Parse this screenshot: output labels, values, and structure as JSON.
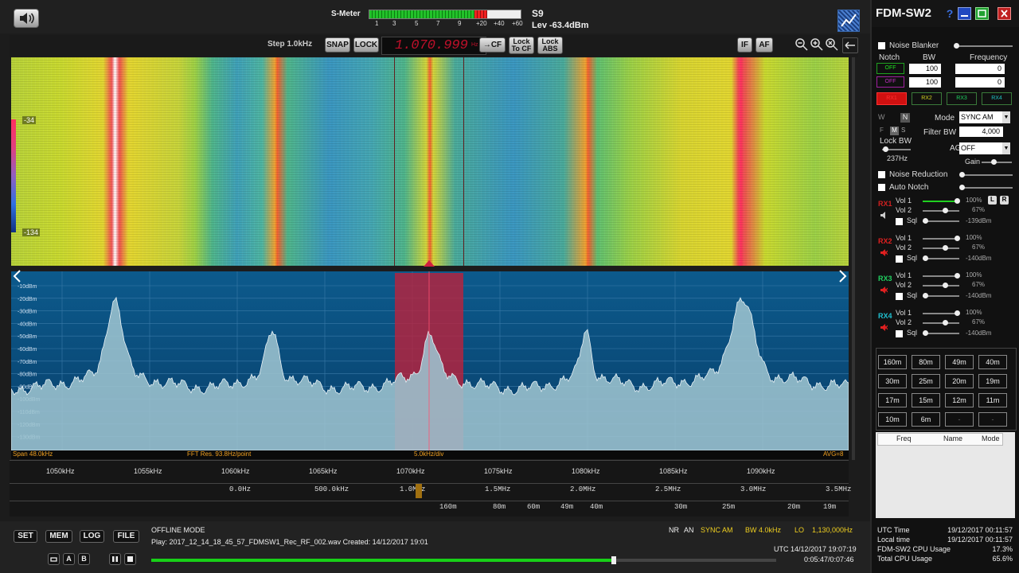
{
  "topbar": {
    "smeter_label": "S-Meter",
    "smeter_ticks": [
      "1",
      "3",
      "5",
      "7",
      "9",
      "+20",
      "+40",
      "+60"
    ],
    "s_reading": "S9",
    "level": "Lev -63.4dBm",
    "smeter_fill": 0.78
  },
  "ctrl": {
    "step": "Step 1.0kHz",
    "snap": "SNAP",
    "lock": "LOCK",
    "frequency": "1.070.999",
    "freq_unit": "Hz",
    "cf": "→CF",
    "lock_to_cf": "Lock To CF",
    "lock_abs": "Lock ABS",
    "if": "IF",
    "af": "AF"
  },
  "waterfall": {
    "top_level": "-34",
    "bottom_level": "-134"
  },
  "spectrum": {
    "db_labels": [
      "-10dBm",
      "-20dBm",
      "-30dBm",
      "-40dBm",
      "-50dBm",
      "-60dBm",
      "-70dBm",
      "-80dBm",
      "-90dBm",
      "-100dBm",
      "-110dBm",
      "-120dBm",
      "-130dBm"
    ],
    "span": "Span 48.0kHz",
    "fft_res": "FFT Res. 93.8Hz/point",
    "div": "5.0kHz/div",
    "avg": "AVG=8"
  },
  "scale": {
    "khz": [
      "1050kHz",
      "1055kHz",
      "1060kHz",
      "1065kHz",
      "1070kHz",
      "1075kHz",
      "1080kHz",
      "1085kHz",
      "1090kHz"
    ],
    "mhz": [
      "0.0Hz",
      "500.0kHz",
      "1.0MHz",
      "1.5MHz",
      "2.0MHz",
      "2.5MHz",
      "3.0MHz",
      "3.5MHz"
    ],
    "meters": [
      "160m",
      "80m",
      "60m",
      "49m",
      "40m",
      "30m",
      "25m",
      "20m",
      "19m"
    ]
  },
  "bottom": {
    "set": "SET",
    "mem": "MEM",
    "log": "LOG",
    "file": "FILE",
    "mode": "OFFLINE MODE",
    "play": "Play: 2017_12_14_18_45_57_FDMSW1_Rec_RF_002.wav Created: 14/12/2017 19:01",
    "nr": "NR",
    "an": "AN",
    "sync": "SYNC AM",
    "bw": "BW 4.0kHz",
    "lo": "LO",
    "lo_freq": "1,130,000Hz",
    "utc": "UTC 14/12/2017 19:07:19",
    "position": "0:05:47/0:07:46",
    "progress": 0.74
  },
  "side": {
    "title": "FDM-SW2",
    "noise_blanker": "Noise Blanker",
    "notch": "Notch",
    "bw": "BW",
    "frequency": "Frequency",
    "notch_rows": [
      {
        "state": "OFF",
        "bw": "100",
        "freq": "0"
      },
      {
        "state": "OFF",
        "bw": "100",
        "freq": "0"
      }
    ],
    "rx_buttons": [
      "RX1",
      "RX2",
      "RX3",
      "RX4"
    ],
    "w": "W",
    "n": "N",
    "f": "F",
    "m": "M",
    "s": "S",
    "mode_label": "Mode",
    "mode_value": "SYNC AM",
    "filter_bw_label": "Filter BW",
    "filter_bw_value": "4,000",
    "lock_bw": "Lock BW",
    "lock_bw_value": "237Hz",
    "agc_label": "AGC",
    "agc_value": "OFF",
    "gain": "Gain",
    "noise_reduction": "Noise Reduction",
    "auto_notch": "Auto Notch",
    "receivers": [
      {
        "name": "RX1",
        "vol1": "Vol 1",
        "vol1_val": "100%",
        "vol2": "Vol 2",
        "vol2_val": "67%",
        "sql": "Sql",
        "sql_val": "-139dBm"
      },
      {
        "name": "RX2",
        "vol1": "Vol 1",
        "vol1_val": "100%",
        "vol2": "Vol 2",
        "vol2_val": "67%",
        "sql": "Sql",
        "sql_val": "-140dBm"
      },
      {
        "name": "RX3",
        "vol1": "Vol 1",
        "vol1_val": "100%",
        "vol2": "Vol 2",
        "vol2_val": "67%",
        "sql": "Sql",
        "sql_val": "-140dBm"
      },
      {
        "name": "RX4",
        "vol1": "Vol 1",
        "vol1_val": "100%",
        "vol2": "Vol 2",
        "vol2_val": "67%",
        "sql": "Sql",
        "sql_val": "-140dBm"
      }
    ],
    "l": "L",
    "r": "R",
    "bands": [
      "160m",
      "80m",
      "49m",
      "40m",
      "30m",
      "25m",
      "20m",
      "19m",
      "17m",
      "15m",
      "12m",
      "11m",
      "10m",
      "6m",
      "-",
      "-"
    ],
    "mem_cols": [
      "Freq",
      "Name",
      "Mode"
    ],
    "status": [
      {
        "label": "UTC Time",
        "value": "19/12/2017 00:11:57"
      },
      {
        "label": "Local time",
        "value": "19/12/2017 00:11:57"
      },
      {
        "label": "FDM-SW2 CPU Usage",
        "value": "17.3%"
      },
      {
        "label": "Total CPU Usage",
        "value": "65.6%"
      }
    ]
  },
  "colors": {
    "accent_green": "#00e000",
    "rx_red": "#e02020",
    "marker": "#d02040"
  }
}
